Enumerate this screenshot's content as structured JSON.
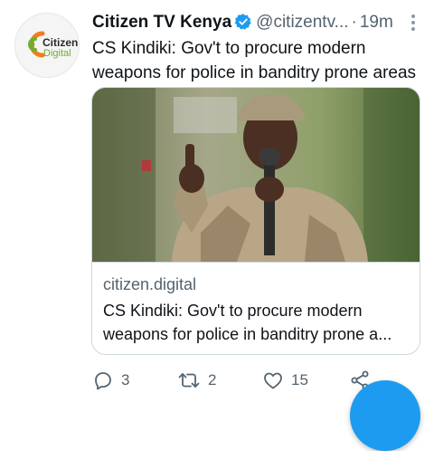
{
  "author": {
    "name": "Citizen TV Kenya",
    "handle": "@citizentv...",
    "separator": "·",
    "time": "19m",
    "avatar_line1": "Citizen",
    "avatar_line2": "Digital"
  },
  "tweet": {
    "text": "CS Kindiki: Gov't to procure modern weapons for police in banditry prone areas"
  },
  "card": {
    "domain": "citizen.digital",
    "title": "CS Kindiki: Gov't to procure modern weapons for police in banditry prone a..."
  },
  "actions": {
    "replies": "3",
    "retweets": "2",
    "likes": "15"
  },
  "icons": {
    "verified": "verified-badge-icon",
    "more": "more-vertical-icon",
    "reply": "reply-icon",
    "retweet": "retweet-icon",
    "like": "heart-icon",
    "share": "share-icon"
  },
  "colors": {
    "accent": "#1d9bf0",
    "muted": "#536471",
    "brand_orange": "#f47b20",
    "brand_green": "#6fae2f"
  }
}
